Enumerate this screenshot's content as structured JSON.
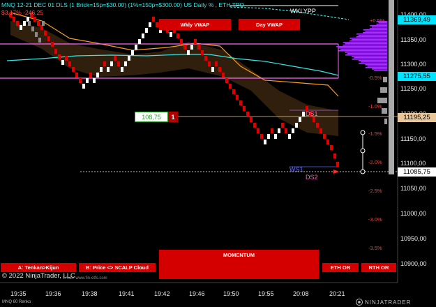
{
  "header": {
    "title": "MNQ 12-21 DEC 01 DLS (1 Brick=15p=$30.00) (1%=150p=$300.00) US Daily % , ETH TPO",
    "subtitle": "$3.17% -246,25",
    "wklypp": "WKLYPP"
  },
  "vwap_buttons": {
    "weekly": "Wkly VWAP",
    "day": "Day VWAP"
  },
  "price_axis": {
    "labels": [
      "11400,00",
      "11350,00",
      "11300,00",
      "11250,00",
      "11200,00",
      "11150,00",
      "11100,00",
      "11050,00",
      "11000,00",
      "10950,00",
      "10900,00"
    ],
    "highlights": [
      {
        "value": "11369,49",
        "bg": "#00e5ff",
        "fg": "#000000"
      },
      {
        "value": "11275,55",
        "bg": "#00e5ff",
        "fg": "#000000"
      },
      {
        "value": "11195,25",
        "bg": "#e8c89a",
        "fg": "#000000"
      },
      {
        "value": "11085,75",
        "bg": "#ffffff",
        "fg": "#000000"
      }
    ]
  },
  "time_axis": [
    "19:35",
    "19:36",
    "19:38",
    "19:41",
    "19:42",
    "19:46",
    "19:50",
    "19:55",
    "20:08",
    "20:21"
  ],
  "percent_levels": {
    "right": [
      "+0.5%",
      "-1.5%",
      "-2.0%",
      "-2.5%",
      "-3.0%",
      "-3.5%"
    ],
    "mid": [
      "-0.5%",
      "-1.0%"
    ]
  },
  "position_box": {
    "price": "108,75",
    "qty": "1"
  },
  "level_labels": {
    "ds1": "DS1",
    "ws1": "WS1",
    "ds2": "DS2"
  },
  "bottom_buttons": {
    "tenkan": "A: Tenkan>Kijun",
    "scalp": "B: Price <> SCALP Cloud",
    "momentum": "MOMENTUM",
    "eth": "ETH OR",
    "rth": "RTH OR"
  },
  "footer": {
    "copyright": "© 2022 NinjaTrader, LLC",
    "url": "Email: www.fin-etfs.com",
    "instrument": "MNQ 60 Renko",
    "brand": "NINJATRADER"
  },
  "colors": {
    "up_brick": "#ffffff",
    "down_brick": "#e00000",
    "magenta_line": "#ff66ff",
    "cyan_line": "#33e6e6",
    "orange_line": "#ff9a1a",
    "tpo_profile": "#a633ff"
  }
}
